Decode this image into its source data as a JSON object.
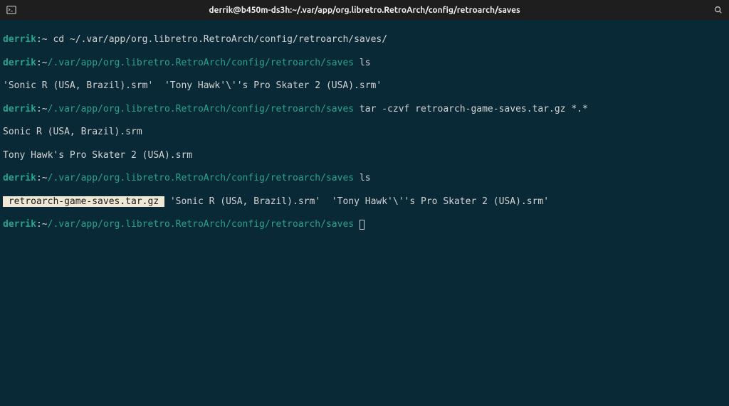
{
  "titlebar": {
    "title": "derrik@b450m-ds3h:~/.var/app/org.libretro.RetroArch/config/retroarch/saves"
  },
  "prompt": {
    "user": "derrik",
    "colon": ":",
    "tilde": "~",
    "path_short": "",
    "path_long": "/.var/app/org.libretro.RetroArch/config/retroarch/saves"
  },
  "lines": {
    "l1_cmd": " cd ~/.var/app/org.libretro.RetroArch/config/retroarch/saves/",
    "l2_cmd": " ls",
    "l3_out": "'Sonic R (USA, Brazil).srm'  'Tony Hawk'\\''s Pro Skater 2 (USA).srm'",
    "l4_cmd": " tar -czvf retroarch-game-saves.tar.gz *.*",
    "l5_out": "Sonic R (USA, Brazil).srm",
    "l6_out": "Tony Hawk's Pro Skater 2 (USA).srm",
    "l7_cmd": " ls",
    "l8_hl": " retroarch-game-saves.tar.gz ",
    "l8_rest": "'Sonic R (USA, Brazil).srm'  'Tony Hawk'\\''s Pro Skater 2 (USA).srm'",
    "l9_cmd": " "
  }
}
